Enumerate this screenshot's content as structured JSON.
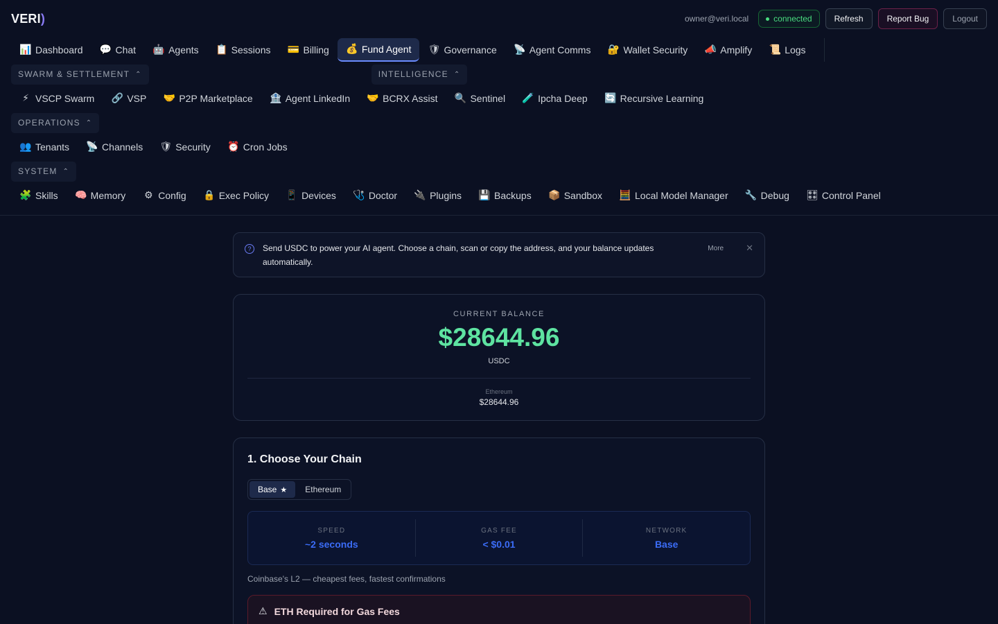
{
  "header": {
    "logo_main": "VERI",
    "logo_paren": ")",
    "email": "owner@veri.local",
    "status": "connected",
    "refresh_label": "Refresh",
    "report_bug_label": "Report Bug",
    "logout_label": "Logout"
  },
  "nav": {
    "primary": [
      {
        "icon": "📊",
        "label": "Dashboard"
      },
      {
        "icon": "💬",
        "label": "Chat"
      },
      {
        "icon": "🤖",
        "label": "Agents"
      },
      {
        "icon": "📋",
        "label": "Sessions"
      },
      {
        "icon": "💳",
        "label": "Billing"
      },
      {
        "icon": "💰",
        "label": "Fund Agent"
      },
      {
        "icon": "🛡",
        "label": "Governance"
      },
      {
        "icon": "📡",
        "label": "Agent Comms"
      },
      {
        "icon": "🔐",
        "label": "Wallet Security"
      },
      {
        "icon": "📣",
        "label": "Amplify"
      },
      {
        "icon": "📜",
        "label": "Logs"
      }
    ],
    "groups": {
      "swarm": "SWARM & SETTLEMENT",
      "intelligence": "INTELLIGENCE",
      "operations": "OPERATIONS",
      "system": "SYSTEM"
    },
    "swarm_items": [
      {
        "icon": "⚡",
        "label": "VSCP Swarm"
      },
      {
        "icon": "🔗",
        "label": "VSP"
      },
      {
        "icon": "🤝",
        "label": "P2P Marketplace"
      },
      {
        "icon": "🏦",
        "label": "Agent LinkedIn"
      },
      {
        "icon": "🤝",
        "label": "BCRX Assist"
      },
      {
        "icon": "🔍",
        "label": "Sentinel"
      },
      {
        "icon": "🧪",
        "label": "Ipcha Deep"
      },
      {
        "icon": "🔄",
        "label": "Recursive Learning"
      }
    ],
    "operations_items": [
      {
        "icon": "👥",
        "label": "Tenants"
      },
      {
        "icon": "📡",
        "label": "Channels"
      },
      {
        "icon": "🛡",
        "label": "Security"
      },
      {
        "icon": "⏰",
        "label": "Cron Jobs"
      }
    ],
    "system_items": [
      {
        "icon": "🧩",
        "label": "Skills"
      },
      {
        "icon": "🧠",
        "label": "Memory"
      },
      {
        "icon": "⚙",
        "label": "Config"
      },
      {
        "icon": "🔒",
        "label": "Exec Policy"
      },
      {
        "icon": "📱",
        "label": "Devices"
      },
      {
        "icon": "🩺",
        "label": "Doctor"
      },
      {
        "icon": "🔌",
        "label": "Plugins"
      },
      {
        "icon": "💾",
        "label": "Backups"
      },
      {
        "icon": "📦",
        "label": "Sandbox"
      },
      {
        "icon": "🧮",
        "label": "Local Model Manager"
      },
      {
        "icon": "🔧",
        "label": "Debug"
      },
      {
        "icon": "🎛",
        "label": "Control Panel"
      }
    ]
  },
  "info": {
    "text": "Send USDC to power your AI agent. Choose a chain, scan or copy the address, and your balance updates automatically.",
    "more": "More",
    "close": "✕"
  },
  "balance": {
    "label": "CURRENT BALANCE",
    "amount": "$28644.96",
    "unit": "USDC",
    "chain_name": "Ethereum",
    "chain_amount": "$28644.96",
    "accent_color": "#5ee3a1"
  },
  "chain": {
    "title": "1. Choose Your Chain",
    "tabs": [
      {
        "label": "Base",
        "star": "★"
      },
      {
        "label": "Ethereum"
      }
    ],
    "stats": [
      {
        "label": "SPEED",
        "value": "~2 seconds"
      },
      {
        "label": "GAS FEE",
        "value": "< $0.01"
      },
      {
        "label": "NETWORK",
        "value": "Base"
      }
    ],
    "description": "Coinbase's L2 — cheapest fees, fastest confirmations",
    "warning_title": "ETH Required for Gas Fees"
  }
}
